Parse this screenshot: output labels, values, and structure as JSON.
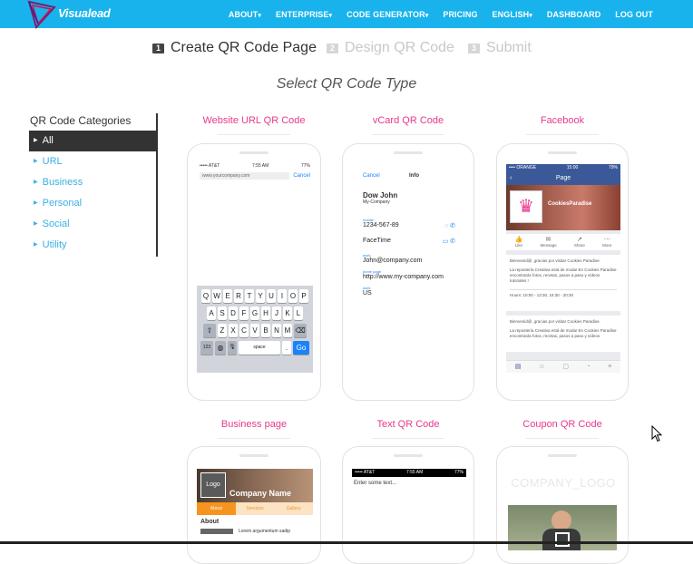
{
  "brand": {
    "name": "Visualead"
  },
  "nav": [
    {
      "label": "ABOUT",
      "caret": true
    },
    {
      "label": "ENTERPRISE",
      "caret": true
    },
    {
      "label": "CODE GENERATOR",
      "caret": true
    },
    {
      "label": "PRICING",
      "caret": false
    },
    {
      "label": "ENGLISH",
      "caret": true
    },
    {
      "label": "DASHBOARD",
      "caret": false
    },
    {
      "label": "LOG OUT",
      "caret": false
    }
  ],
  "steps": [
    {
      "num": "1",
      "label": "Create QR Code Page",
      "active": true
    },
    {
      "num": "2",
      "label": "Design QR Code",
      "active": false
    },
    {
      "num": "3",
      "label": "Submit",
      "active": false
    }
  ],
  "subtitle": "Select QR Code Type",
  "sidebar": {
    "title": "QR Code Categories",
    "items": [
      {
        "label": "All",
        "active": true
      },
      {
        "label": "URL",
        "active": false
      },
      {
        "label": "Business",
        "active": false
      },
      {
        "label": "Personal",
        "active": false
      },
      {
        "label": "Social",
        "active": false
      },
      {
        "label": "Utility",
        "active": false
      }
    ]
  },
  "cards": [
    {
      "title": "Website URL QR Code"
    },
    {
      "title": "vCard QR Code"
    },
    {
      "title": "Facebook"
    },
    {
      "title": "Business page"
    },
    {
      "title": "Text QR Code"
    },
    {
      "title": "Coupon QR Code"
    }
  ],
  "url_screen": {
    "carrier": "••••• AT&T",
    "time": "7:55 AM",
    "battery": "77%",
    "address": "www.yourcompany.com",
    "cancel": "Cancel",
    "rows": [
      [
        "Q",
        "W",
        "E",
        "R",
        "T",
        "Y",
        "U",
        "I",
        "O",
        "P"
      ],
      [
        "A",
        "S",
        "D",
        "F",
        "G",
        "H",
        "J",
        "K",
        "L"
      ],
      [
        "Z",
        "X",
        "C",
        "V",
        "B",
        "N",
        "M"
      ]
    ],
    "num_key": "123",
    "space": "space",
    "dot": ".",
    "go": "Go"
  },
  "vcard_screen": {
    "cancel": "Cancel",
    "info": "Info",
    "name": "Dow John",
    "company": "My-Company",
    "mobile_label": "mobile",
    "mobile": "1234-567-89",
    "facetime": "FaceTime",
    "email_label": "work",
    "email": "John@company.com",
    "home_label": "home page",
    "home": "http://www.my-company.com",
    "address_label": "work",
    "address": "US"
  },
  "facebook_screen": {
    "carrier": "•••• ORANGE",
    "time": "15:00",
    "battery": "79%",
    "page": "Page",
    "page_name": "CookiesParadise",
    "actions": [
      "Like",
      "Message",
      "Share",
      "More"
    ],
    "post1_title": "Bienvenid@, gracias por visitar Cookies Paradise.",
    "post1_body": "La repostería Creativa está de moda! En Cookies Paradise encontrarás fotos, recetas, pasos a paso y vídeos tutoriales !",
    "hours": "Hours: 10:00 - 13:30, 16:30 - 20:30",
    "post2_title": "Bienvenid@, gracias por visitar Cookies Paradise.",
    "post2_body": "La repostería Creativa está de moda! En Cookies Paradise encontrarás fotos, recetas, pasos a paso y vídeos"
  },
  "business_screen": {
    "logo": "Logo",
    "company": "Company Name",
    "tabs": [
      "About",
      "Services",
      "Gallery"
    ],
    "about": "About",
    "lorem": "Lorem argumentum sadip"
  },
  "text_screen": {
    "carrier": "••••• AT&T",
    "time": "7:55 AM",
    "battery": "77%",
    "placeholder": "Enter some text..."
  },
  "coupon_screen": {
    "logo": "COMPANY_LOGO"
  },
  "colors": {
    "navbar": "#18b3ec",
    "accent_pink": "#e8398d",
    "link_blue": "#3ab0e4",
    "facebook_blue": "#3b5998",
    "business_orange": "#f7941d"
  }
}
